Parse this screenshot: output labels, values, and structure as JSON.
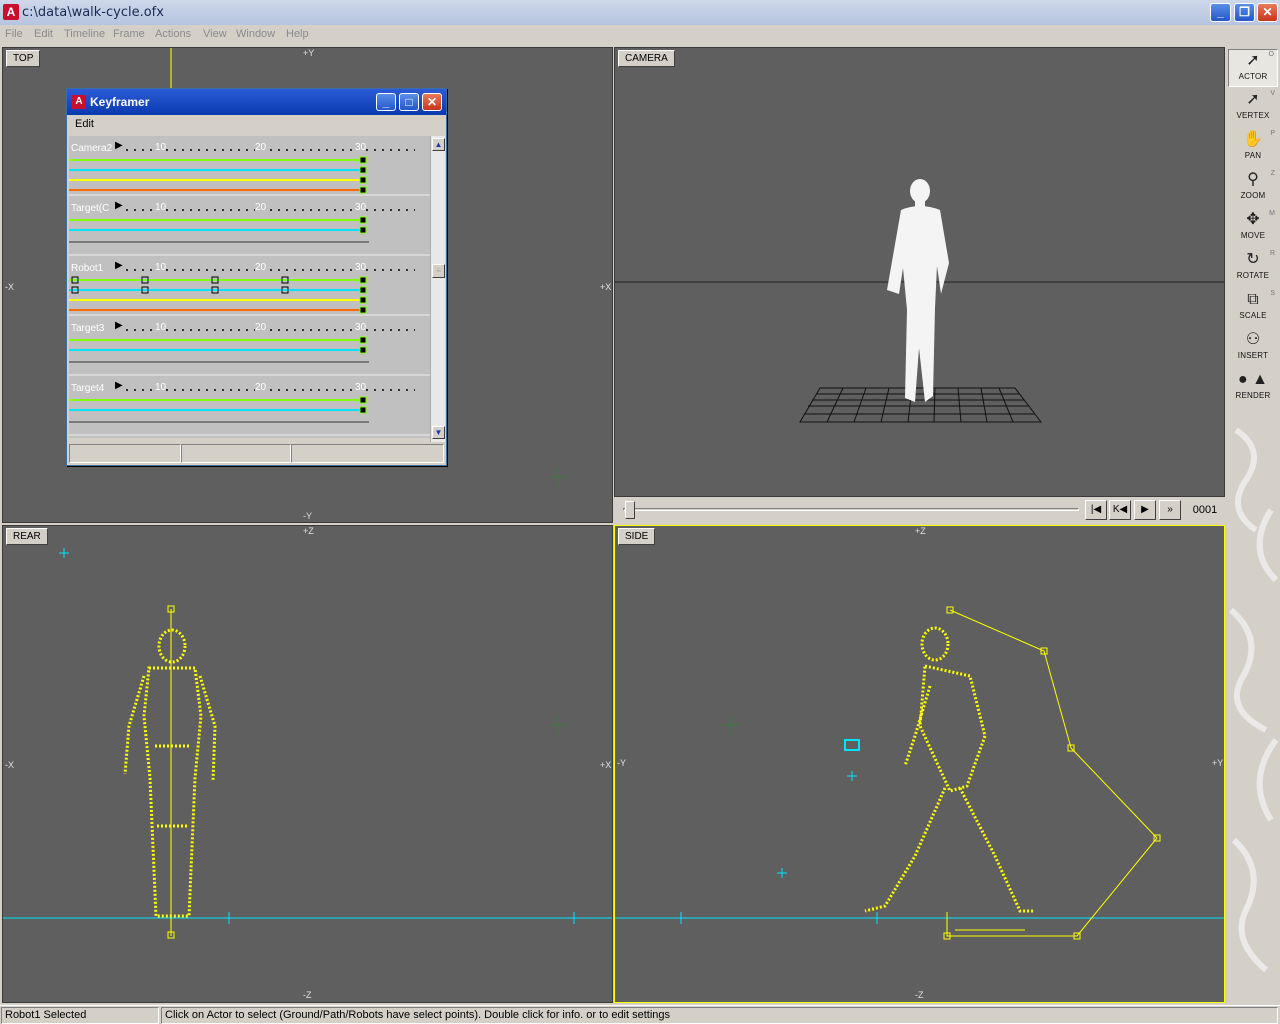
{
  "window": {
    "title": "c:\\data\\walk-cycle.ofx",
    "app_icon": "A"
  },
  "menu": [
    "File",
    "Edit",
    "Timeline",
    "Frame",
    "Actions",
    "View",
    "Window",
    "Help"
  ],
  "viewports": {
    "top": {
      "label": "TOP",
      "axes": {
        "top": "+Y",
        "bottom": "-Y",
        "left": "-X",
        "right": "+X"
      }
    },
    "camera": {
      "label": "CAMERA"
    },
    "rear": {
      "label": "REAR",
      "axes": {
        "top": "+Z",
        "bottom": "-Z",
        "left": "-X",
        "right": "+X"
      }
    },
    "side": {
      "label": "SIDE",
      "axes": {
        "top": "+Z",
        "bottom": "-Z",
        "left": "-Y",
        "right": "+Y"
      }
    }
  },
  "keyframer": {
    "title": "Keyframer",
    "menu": "Edit",
    "ticks": [
      "10",
      "20",
      "30"
    ],
    "tracks": [
      {
        "name": "Camera2"
      },
      {
        "name": "Target(C"
      },
      {
        "name": "Robot1"
      },
      {
        "name": "Target3"
      },
      {
        "name": "Target4"
      }
    ]
  },
  "transport": {
    "frame": "0001",
    "buttons": [
      "first-frame",
      "prev-key",
      "play",
      "fast-forward"
    ]
  },
  "toolbar": [
    {
      "label": "ACTOR",
      "key": "O",
      "icon": "pointer-icon"
    },
    {
      "label": "VERTEX",
      "key": "V",
      "icon": "vertex-pointer-icon"
    },
    {
      "label": "PAN",
      "key": "P",
      "icon": "hand-icon"
    },
    {
      "label": "ZOOM",
      "key": "Z",
      "icon": "magnifier-icon"
    },
    {
      "label": "MOVE",
      "key": "M",
      "icon": "move-arrows-icon"
    },
    {
      "label": "ROTATE",
      "key": "R",
      "icon": "rotate-icon"
    },
    {
      "label": "SCALE",
      "key": "S",
      "icon": "scale-icon"
    },
    {
      "label": "INSERT",
      "key": "",
      "icon": "insert-icon"
    },
    {
      "label": "RENDER",
      "key": "",
      "icon": "render-icon"
    }
  ],
  "status": {
    "selection": "Robot1 Selected",
    "hint": "Click on Actor to select  (Ground/Path/Robots have select points). Double click for info. or to edit settings"
  },
  "colors": {
    "viewport_bg": "#5f5f5f",
    "actor": "#ffff00",
    "path": "#ffff00",
    "ground": "#00e5ff",
    "keyframe_green": "#7fff00",
    "keyframe_cyan": "#00e5ff",
    "keyframe_yellow": "#ffff00",
    "keyframe_orange": "#ff6a00"
  }
}
